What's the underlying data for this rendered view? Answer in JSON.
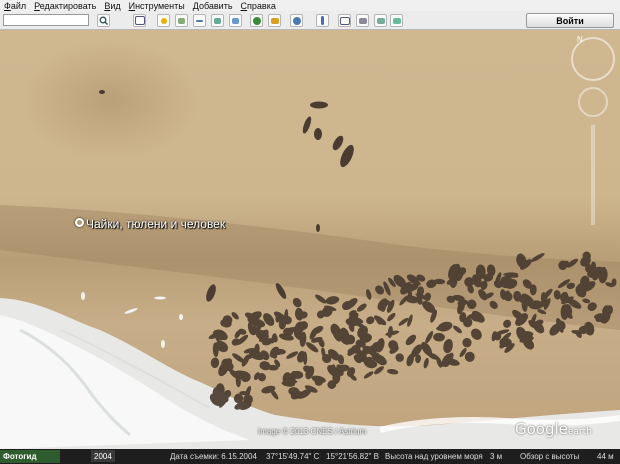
{
  "menu": {
    "items": [
      "Файл",
      "Редактировать",
      "Вид",
      "Инструменты",
      "Добавить",
      "Справка"
    ]
  },
  "toolbar": {
    "search_value": "",
    "login_label": "Войти"
  },
  "map": {
    "placemark_label": "Чайки, тюлени и человек",
    "copyright": "Image © 2013 CNES / Astrium",
    "logo": "Google",
    "logo_suffix": "earth",
    "compass_north": "N"
  },
  "statusbar": {
    "start_label": "Фотогид",
    "timeline_year": "2004",
    "imagery_date": "Дата съемки: 6.15.2004",
    "lat": "37°15'49.74\" С",
    "lon": "15°21'56.82\" В",
    "elevation": "Высота над уровнем моря",
    "elev_value": "3 м",
    "eye_alt": "Обзор с высоты",
    "eye_alt_value": "44 м"
  },
  "colors": {
    "sand": "#cdb58e",
    "wet_sand": "#b89e77",
    "surf": "#f4f4f4",
    "seal": "#4a3c30"
  }
}
